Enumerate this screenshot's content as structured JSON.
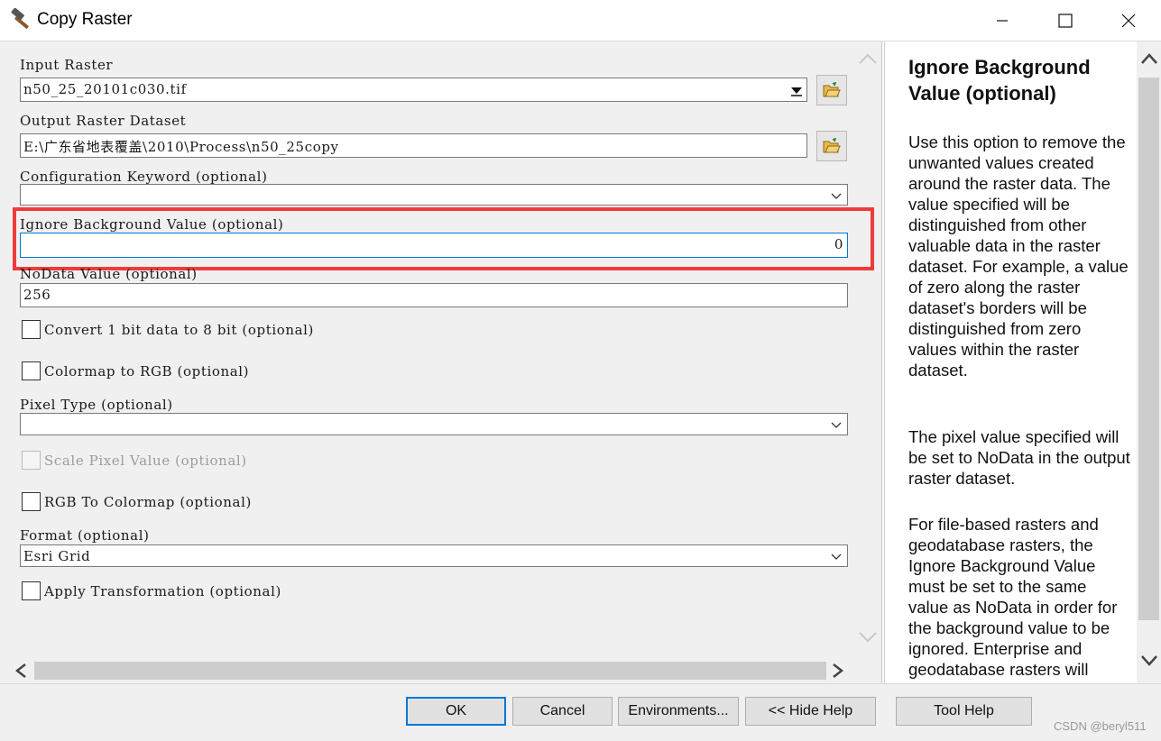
{
  "window": {
    "title": "Copy Raster",
    "icon": "hammer-icon"
  },
  "form": {
    "input_raster": {
      "label": "Input Raster",
      "value": "n50_25_20101c030.tif"
    },
    "output_raster": {
      "label": "Output Raster Dataset",
      "value": "E:\\广东省地表覆盖\\2010\\Process\\n50_25copy"
    },
    "config_keyword": {
      "label": "Configuration Keyword (optional)",
      "value": ""
    },
    "ignore_background": {
      "label": "Ignore Background Value (optional)",
      "value": "0"
    },
    "nodata": {
      "label": "NoData Value (optional)",
      "value": "256"
    },
    "convert_1bit": {
      "label": "Convert 1 bit data to 8 bit (optional)",
      "checked": false
    },
    "colormap_to_rgb": {
      "label": "Colormap to RGB (optional)",
      "checked": false
    },
    "pixel_type": {
      "label": "Pixel Type (optional)",
      "value": ""
    },
    "scale_pixel": {
      "label": "Scale Pixel Value (optional)",
      "checked": false,
      "enabled": false
    },
    "rgb_to_colormap": {
      "label": "RGB To Colormap (optional)",
      "checked": false
    },
    "format": {
      "label": "Format (optional)",
      "value": "Esri Grid"
    },
    "apply_transform": {
      "label": "Apply Transformation (optional)",
      "checked": false
    }
  },
  "help": {
    "title": "Ignore Background Value (optional)",
    "paragraphs": [
      "Use this option to remove the unwanted values created around the raster data. The value specified will be distinguished from other valuable data in the raster dataset. For example, a value of zero along the raster dataset's borders will be distinguished from zero values within the raster dataset.",
      "The pixel value specified will be set to NoData in the output raster dataset.",
      "For file-based rasters and geodatabase rasters, the Ignore Background Value must be set to the same value as NoData in order for the background value to be ignored. Enterprise and geodatabase rasters will"
    ]
  },
  "buttons": {
    "ok": "OK",
    "cancel": "Cancel",
    "environments": "Environments...",
    "hide_help": "<< Hide Help",
    "tool_help": "Tool Help"
  },
  "watermark": "CSDN @beryl511",
  "colors": {
    "highlight": "#ef3b3b",
    "default_button_border": "#0078d7"
  }
}
